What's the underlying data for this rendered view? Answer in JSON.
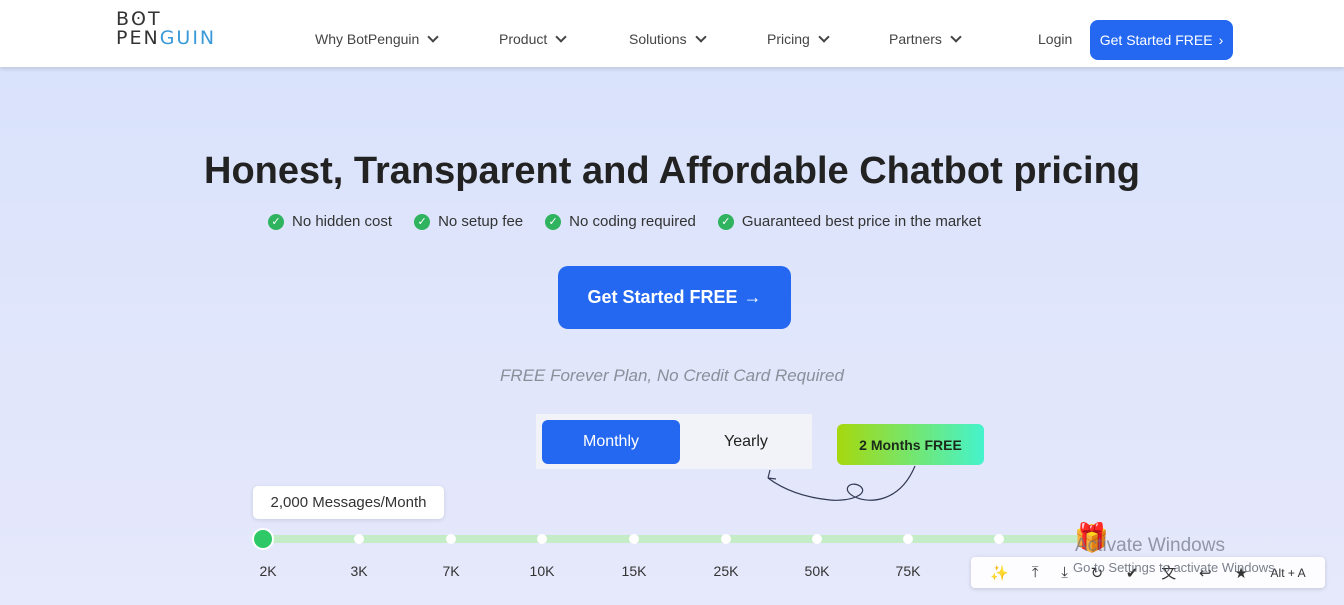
{
  "nav": {
    "logo_top": "BʘT",
    "logo_pen": "PEN",
    "logo_guin": "GUIN",
    "items": [
      "Why BotPenguin",
      "Product",
      "Solutions",
      "Pricing",
      "Partners"
    ],
    "login": "Login",
    "cta": "Get Started FREE"
  },
  "hero": {
    "title": "Honest, Transparent and Affordable Chatbot pricing",
    "features": [
      "No hidden cost",
      "No setup fee",
      "No coding required",
      "Guaranteed best price in the market"
    ],
    "cta": "Get Started FREE",
    "subtitle": "FREE Forever Plan, No Credit Card Required"
  },
  "billing": {
    "monthly": "Monthly",
    "yearly": "Yearly",
    "selected": "Monthly",
    "badge": "2 Months FREE"
  },
  "slider": {
    "tooltip": "2,000 Messages/Month",
    "ticks": [
      "2K",
      "3K",
      "7K",
      "10K",
      "15K",
      "25K",
      "50K",
      "75K"
    ],
    "selected_index": 0
  },
  "watermark": {
    "line1": "Activate Windows",
    "line2": "Go to Settings to activate Windows."
  },
  "toolbar": {
    "icons": [
      "magic-wand-icon",
      "align-top-icon",
      "align-bottom-icon",
      "refresh-icon",
      "double-check-icon",
      "translate-icon",
      "reply-icon",
      "star-icon"
    ],
    "glyphs": [
      "✨",
      "⤒",
      "⤓",
      "↻",
      "✔",
      "文",
      "↩",
      "★"
    ],
    "shortcut": "Alt + A"
  },
  "colors": {
    "accent": "#2468f2",
    "success": "#2fb35e"
  }
}
